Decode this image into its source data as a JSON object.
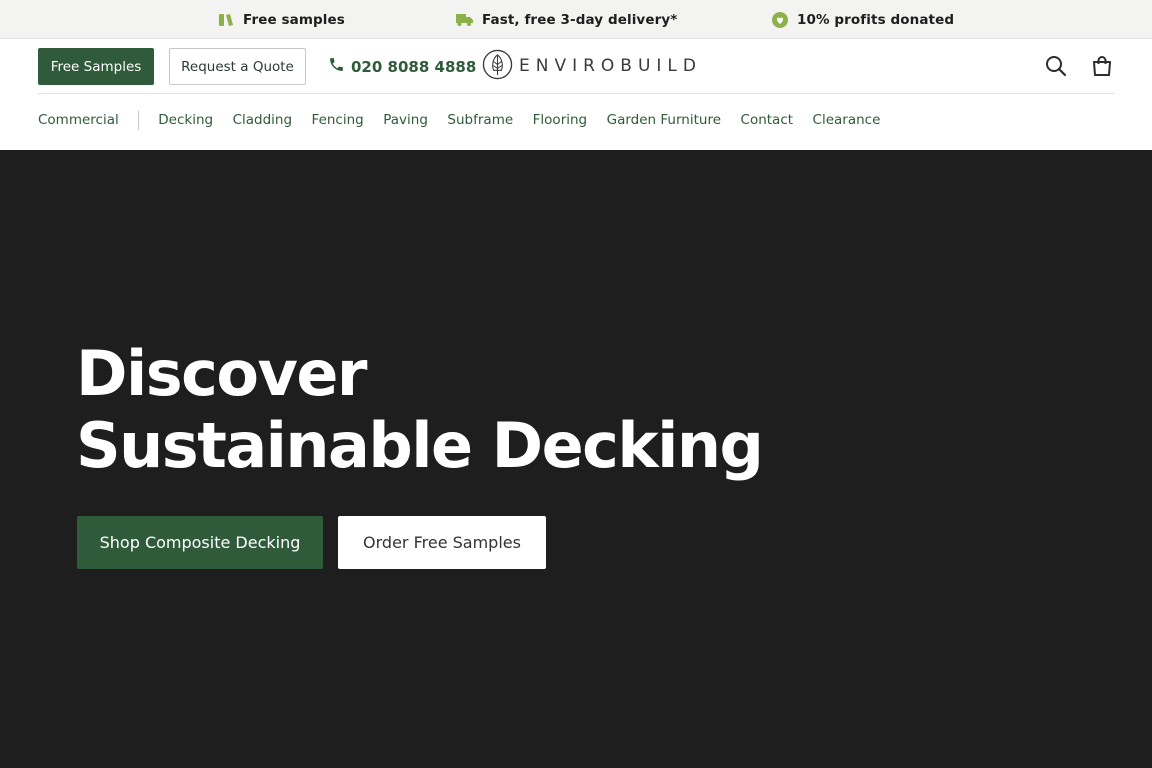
{
  "benefits": [
    {
      "icon": "samples-icon",
      "label": "Free samples"
    },
    {
      "icon": "delivery-truck-icon",
      "label": "Fast, free 3-day delivery*"
    },
    {
      "icon": "heart-leaf-icon",
      "label": "10% profits donated"
    }
  ],
  "header": {
    "free_samples_label": "Free Samples",
    "request_quote_label": "Request a Quote",
    "phone": "020 8088 4888",
    "logo_text": "ENVIROBUILD"
  },
  "nav": {
    "items": [
      "Commercial",
      "Decking",
      "Cladding",
      "Fencing",
      "Paving",
      "Subframe",
      "Flooring",
      "Garden Furniture",
      "Contact",
      "Clearance"
    ]
  },
  "hero": {
    "title_line1": "Discover",
    "title_line2": "Sustainable Decking",
    "primary_cta": "Shop Composite Decking",
    "secondary_cta": "Order Free Samples"
  },
  "colors": {
    "brand_green": "#2f5b3a",
    "icon_green": "#8cb04a",
    "hero_bg": "#1e1e1f",
    "topbar_bg": "#f3f3f2"
  }
}
